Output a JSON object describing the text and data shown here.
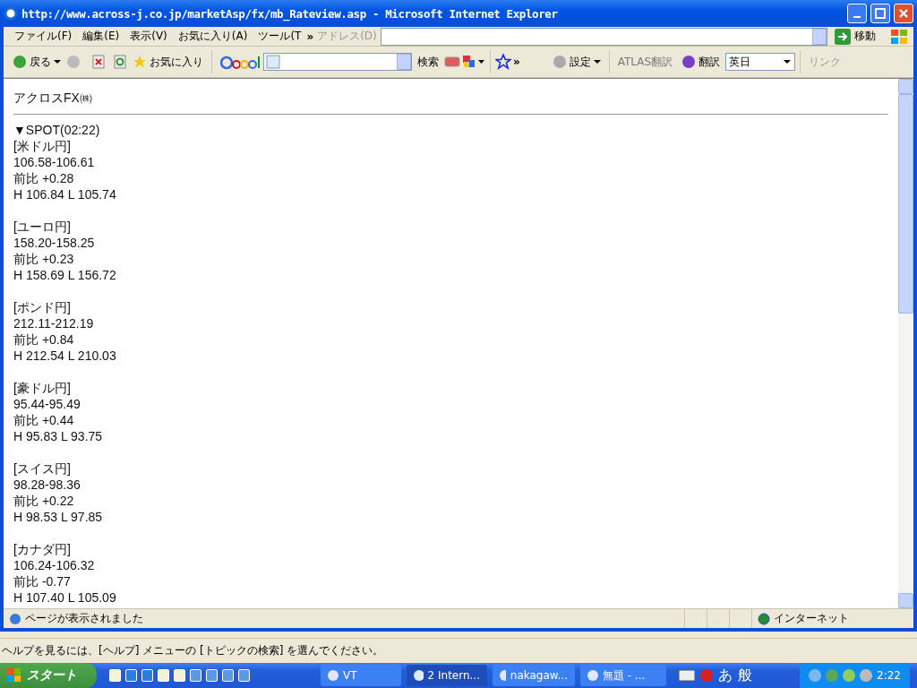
{
  "window": {
    "title": "http://www.across-j.co.jp/marketAsp/fx/mb_Rateview.asp - Microsoft Internet Explorer"
  },
  "menu": [
    "ファイル(F)",
    "編集(E)",
    "表示(V)",
    "お気に入り(A)",
    "ツール(T"
  ],
  "menu_more": "»",
  "address": {
    "label": "アドレス(D)",
    "go": "移動"
  },
  "toolbar": {
    "back": "戻る",
    "favorites": "お気に入り",
    "search": "検索",
    "more": "»",
    "settings": "設定",
    "atlas": "ATLAS翻訳",
    "translate": "翻訳",
    "language": "英日",
    "links": "リンク"
  },
  "page": {
    "heading": "アクロスFX㈱",
    "spot": "▼SPOT(02:22)",
    "rates": [
      {
        "name": "[米ドル円]",
        "quote": "106.58-106.61",
        "change": "前比 +0.28",
        "range": "H 106.84 L 105.74"
      },
      {
        "name": "[ユーロ円]",
        "quote": "158.20-158.25",
        "change": "前比 +0.23",
        "range": "H 158.69 L 156.72"
      },
      {
        "name": "[ポンド円]",
        "quote": "212.11-212.19",
        "change": "前比 +0.84",
        "range": "H 212.54 L 210.03"
      },
      {
        "name": "[豪ドル円]",
        "quote": "95.44-95.49",
        "change": "前比 +0.44",
        "range": "H 95.83 L 93.75"
      },
      {
        "name": "[スイス円]",
        "quote": "98.28-98.36",
        "change": "前比 +0.22",
        "range": "H 98.53 L 97.85"
      },
      {
        "name": "[カナダ円]",
        "quote": "106.24-106.32",
        "change": "前比 -0.77",
        "range": "H 107.40 L 105.09"
      }
    ]
  },
  "status_bar": {
    "message": "ページが表示されました",
    "zone": "インターネット"
  },
  "help_bar": "ヘルプを見るには、[ヘルプ] メニューの [トピックの検索] を選んでください。",
  "taskbar": {
    "start": "スタート",
    "tasks": [
      {
        "label": "VT",
        "selected": false
      },
      {
        "label": "2 Intern...",
        "selected": true
      },
      {
        "label": "nakagaw...",
        "selected": false
      },
      {
        "label": "無題 - ...",
        "selected": false
      }
    ],
    "ime": [
      "あ",
      "般"
    ],
    "clock": "2:22"
  }
}
